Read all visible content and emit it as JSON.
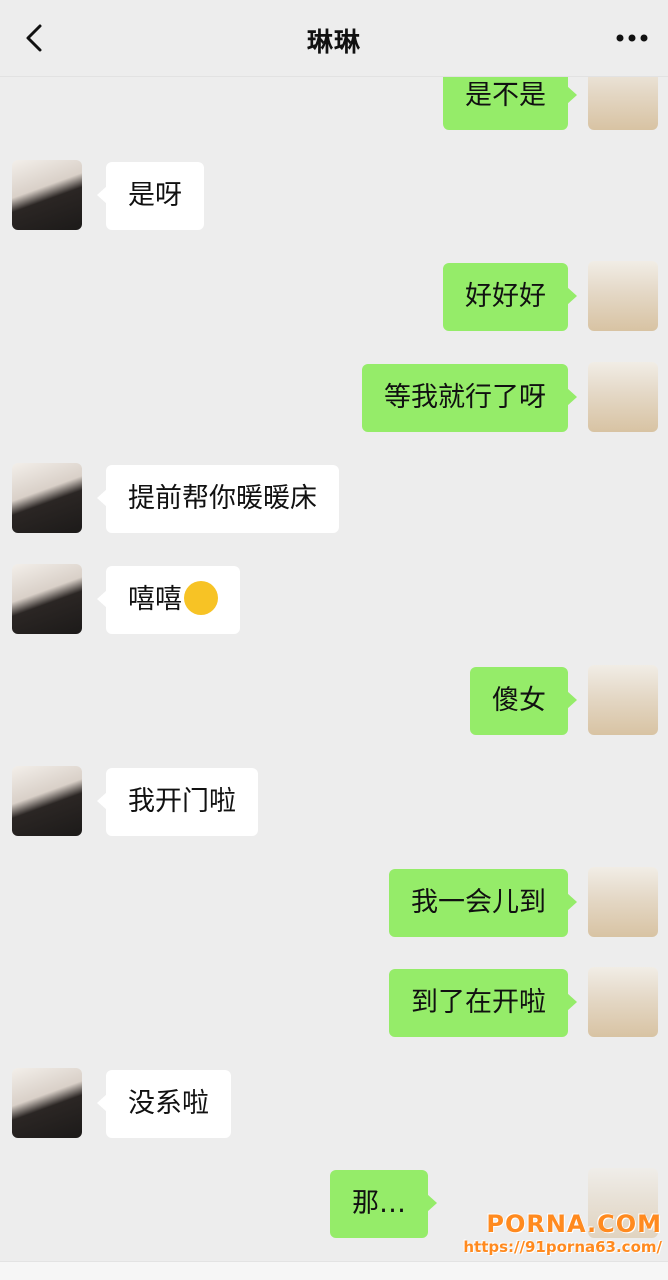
{
  "header": {
    "title": "琳琳"
  },
  "messages": [
    {
      "side": "right",
      "text": "是不是"
    },
    {
      "side": "left",
      "text": "是呀"
    },
    {
      "side": "right",
      "text": "好好好"
    },
    {
      "side": "right",
      "text": "等我就行了呀"
    },
    {
      "side": "left",
      "text": "提前帮你暖暖床"
    },
    {
      "side": "left",
      "text": "嘻嘻",
      "emoji": "winking-tongue-emoji"
    },
    {
      "side": "right",
      "text": "傻女"
    },
    {
      "side": "left",
      "text": "我开门啦"
    },
    {
      "side": "right",
      "text": "我一会儿到"
    },
    {
      "side": "right",
      "text": "到了在开啦"
    },
    {
      "side": "left",
      "text": "没系啦"
    },
    {
      "side": "right",
      "text": "那…"
    }
  ],
  "watermark": {
    "brand": "PORNA.COM",
    "url": "https://91porna63.com/"
  },
  "colors": {
    "background": "#ededed",
    "my_bubble": "#95ec69",
    "their_bubble": "#ffffff",
    "watermark": "#ff8a1f"
  },
  "icons": {
    "back": "chevron-left-icon",
    "more": "more-dots-icon"
  }
}
